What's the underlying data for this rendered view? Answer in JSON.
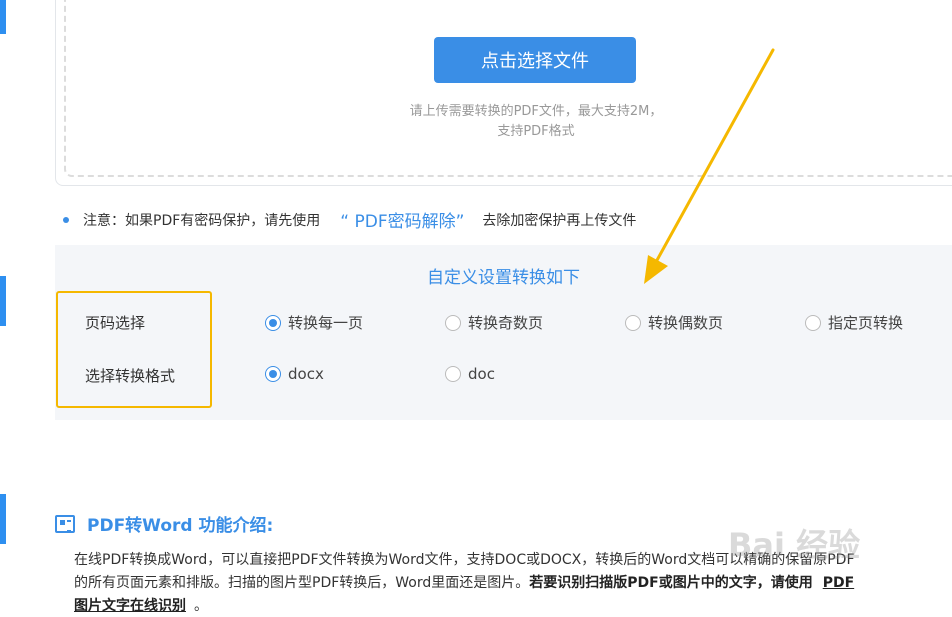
{
  "upload": {
    "button_label": "点击选择文件",
    "hint_line1": "请上传需要转换的PDF文件，最大支持2M，",
    "hint_line2": "支持PDF格式"
  },
  "note": {
    "prefix": "注意：如果PDF有密码保护，请先使用",
    "link": "“ PDF密码解除”",
    "suffix": "去除加密保护再上传文件"
  },
  "settings": {
    "title": "自定义设置转换如下",
    "page_label": "页码选择",
    "page_options": [
      "转换每一页",
      "转换奇数页",
      "转换偶数页",
      "指定页转换"
    ],
    "page_selected": 0,
    "format_label": "选择转换格式",
    "format_options": [
      "docx",
      "doc"
    ],
    "format_selected": 0
  },
  "intro": {
    "title": "PDF转Word 功能介绍:",
    "line1": "在线PDF转换成Word，可以直接把PDF文件转换为Word文件，支持DOC或DOCX，转换后的Word文档可以精确的保留原PDF",
    "line2_normal": "的所有页面元素和排版。扫描的图片型PDF转换后，Word里面还是图片。",
    "line2_bold": "若要识别扫描版PDF或图片中的文字，请使用",
    "line2_link": "PDF",
    "line3_bold": "图片文字在线识别",
    "line3_end": "。"
  },
  "watermark": "Bai 经验",
  "colors": {
    "accent": "#3a8ee6",
    "highlight": "#f5b800",
    "arrow": "#f5b800"
  }
}
